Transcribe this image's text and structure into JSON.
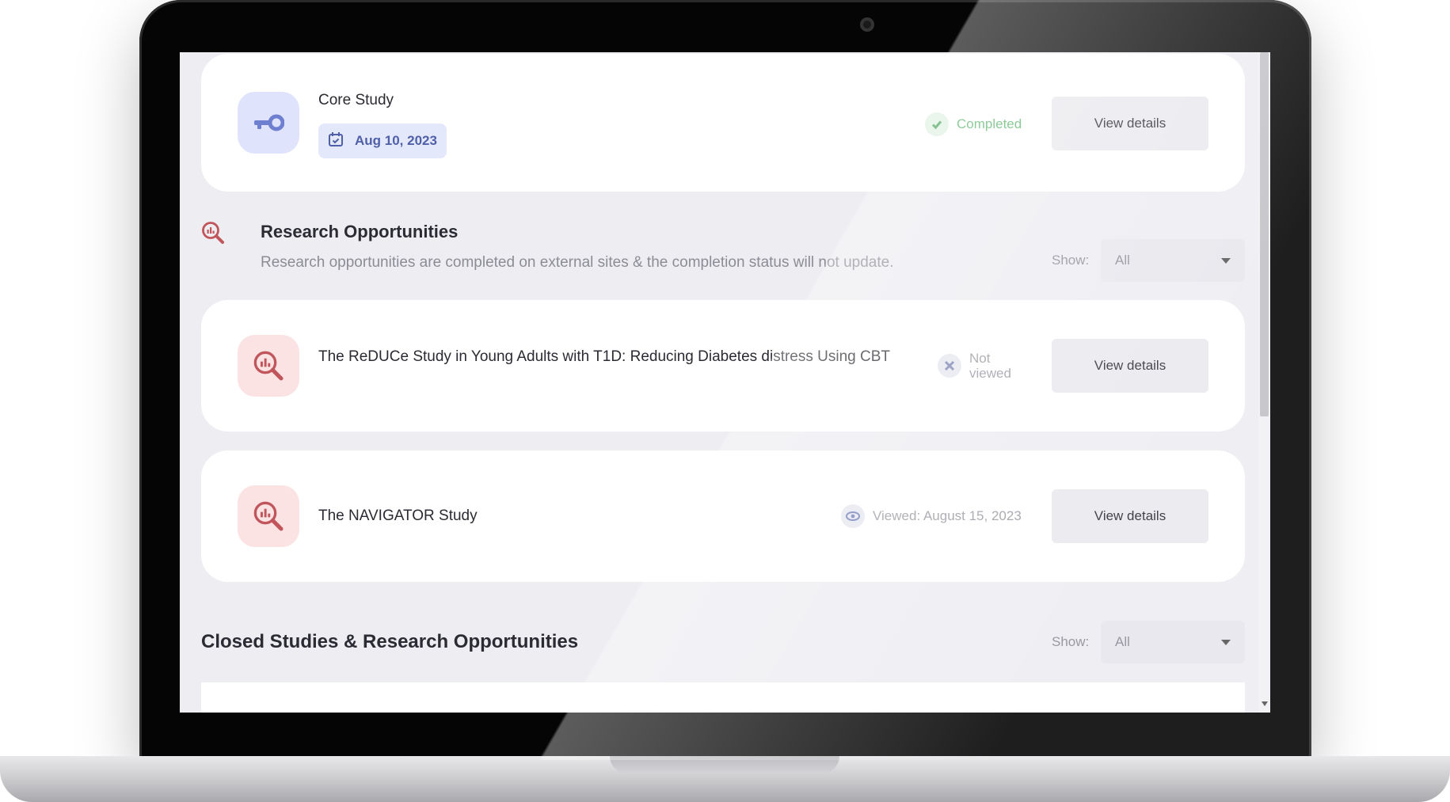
{
  "core_study": {
    "title": "Core Study",
    "date": "Aug 10, 2023",
    "status": "Completed",
    "status_color": "#5bb36a",
    "button": "View details",
    "icon": "key-icon"
  },
  "research": {
    "title": "Research Opportunities",
    "description": "Research opportunities are completed on external sites & the completion status will not update.",
    "show_label": "Show:",
    "filter_value": "All",
    "icon": "research-search-icon",
    "items": [
      {
        "title": "The ReDUCe Study in Young Adults with T1D: Reducing Diabetes distress Using CBT",
        "status": "Not viewed",
        "status_icon": "x-icon",
        "button": "View details"
      },
      {
        "title": "The NAVIGATOR Study",
        "status": "Viewed: August 15, 2023",
        "status_icon": "eye-icon",
        "button": "View details"
      }
    ]
  },
  "closed": {
    "title": "Closed Studies & Research Opportunities",
    "show_label": "Show:",
    "filter_value": "All"
  },
  "colors": {
    "accent_blue": "#4f5fa8",
    "accent_pink": "#c0565c",
    "completed_green": "#5bb36a"
  }
}
